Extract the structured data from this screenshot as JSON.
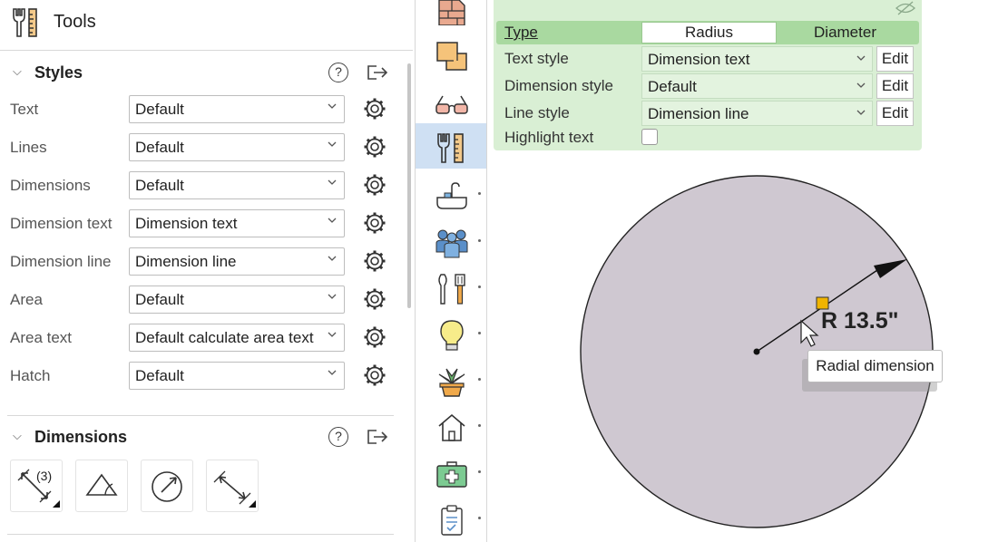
{
  "panel": {
    "title": "Tools",
    "icon": "tools-icon"
  },
  "styles_section": {
    "title": "Styles",
    "help_label": "?",
    "rows": [
      {
        "label": "Text",
        "value": "Default"
      },
      {
        "label": "Lines",
        "value": "Default"
      },
      {
        "label": "Dimensions",
        "value": "Default"
      },
      {
        "label": "Dimension text",
        "value": "Dimension text"
      },
      {
        "label": "Dimension line",
        "value": "Dimension line"
      },
      {
        "label": "Area",
        "value": "Default"
      },
      {
        "label": "Area text",
        "value": "Default calculate area text"
      },
      {
        "label": "Hatch",
        "value": "Default"
      }
    ]
  },
  "dimensions_section": {
    "title": "Dimensions",
    "help_label": "?",
    "tools": [
      "linear-dimension-icon",
      "angular-dimension-icon",
      "radial-dimension-icon",
      "aligned-dimension-icon"
    ]
  },
  "icon_strip": {
    "items": [
      "wall-icon",
      "floor-plan-icon",
      "glasses-icon",
      "tools-icon",
      "bathtub-icon",
      "people-icon",
      "kitchen-utensils-icon",
      "lightbulb-icon",
      "plant-icon",
      "house-icon",
      "medical-kit-icon",
      "clipboard-icon"
    ],
    "active": "tools-icon"
  },
  "properties": {
    "type_label": "Type",
    "type_options": [
      "Radius",
      "Diameter"
    ],
    "type_selected": "Radius",
    "text_style_label": "Text style",
    "text_style_value": "Dimension text",
    "dimension_style_label": "Dimension style",
    "dimension_style_value": "Default",
    "line_style_label": "Line style",
    "line_style_value": "Dimension line",
    "highlight_text_label": "Highlight text",
    "highlight_checked": false,
    "edit_label": "Edit"
  },
  "canvas": {
    "dimension_text": "R 13.5\"",
    "tooltip": "Radial dimension",
    "circle_fill": "#cfc8d1",
    "handle_color": "#f0b400"
  },
  "colors": {
    "panel_bg": "#d9efd4",
    "type_row_bg": "#a9d9a0",
    "active_strip_bg": "#cfe0f3"
  }
}
